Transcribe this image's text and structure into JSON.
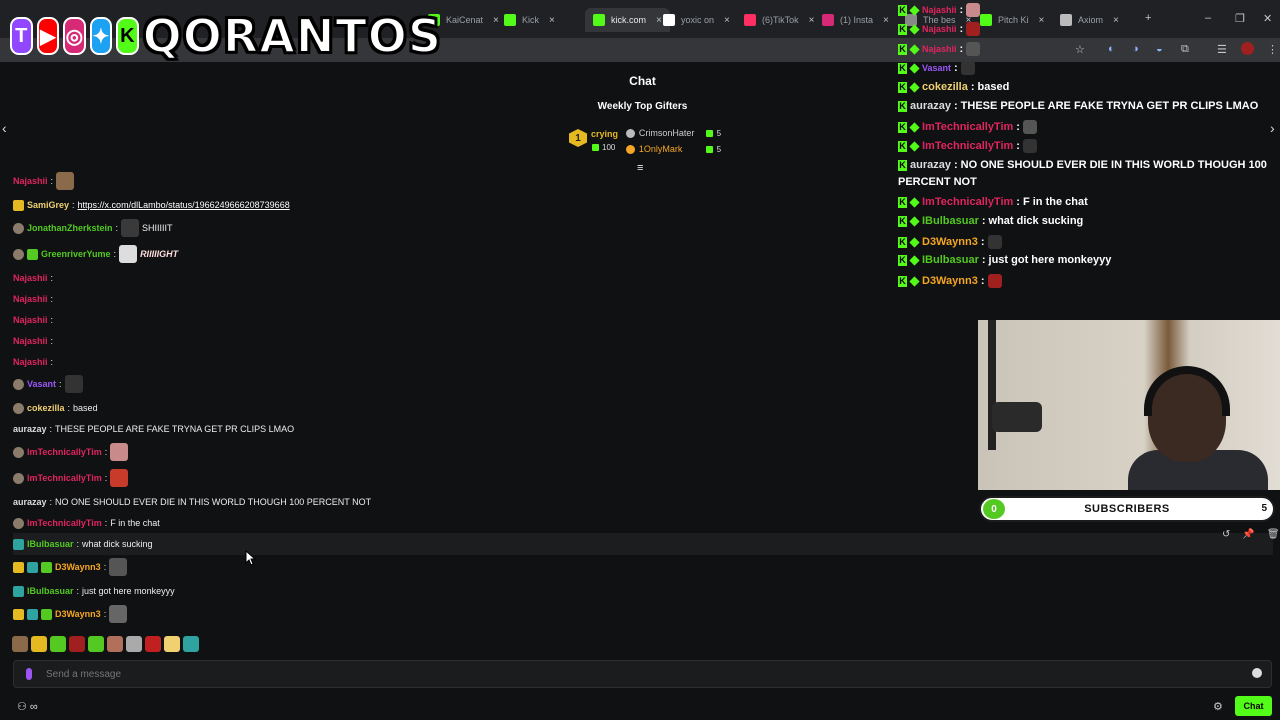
{
  "browser": {
    "tabs": [
      {
        "label": "KaiCenat",
        "color": "#53fc18",
        "active": false
      },
      {
        "label": "Kick",
        "color": "#53fc18",
        "active": false
      },
      {
        "label": "kick.com",
        "color": "#53fc18",
        "active": true
      },
      {
        "label": "yoxic on",
        "color": "#ffffff",
        "active": false
      },
      {
        "label": "(6)TikTok",
        "color": "#ff2e63",
        "active": false
      },
      {
        "label": "(1) Insta",
        "color": "#d62976",
        "active": false
      },
      {
        "label": "The bes",
        "color": "#888888",
        "active": false
      },
      {
        "label": "Pitch Ki",
        "color": "#53fc18",
        "active": false
      },
      {
        "label": "Axiom",
        "color": "#bbbbbb",
        "active": false
      }
    ],
    "new_tab": "+",
    "minimize": "–",
    "restore": "❐",
    "close": "✕"
  },
  "overlay_brand": {
    "name": "QORANTOS",
    "icons": [
      "twitch-icon",
      "youtube-icon",
      "instagram-icon",
      "twitter-icon",
      "kick-icon"
    ],
    "icon_letters": [
      "T",
      "▶",
      "◎",
      "✦",
      "K"
    ]
  },
  "chat": {
    "title": "Chat",
    "weekly_title": "Weekly Top Gifters",
    "top_gifter": {
      "rank": "1",
      "name": "crying",
      "count": "100"
    },
    "gifters": [
      {
        "name": "CrimsonHater",
        "count": "5",
        "color": "#cccccc"
      },
      {
        "name": "1OnlyMark",
        "count": "5",
        "color": "#f5a623"
      }
    ],
    "pin_icon": "≡",
    "nav_left": "‹",
    "nav_right": "›",
    "messages": [
      {
        "user": "Najashii",
        "color": "#e0245e",
        "text": "",
        "emote": "#8a6a4a"
      },
      {
        "user": "SamiGrey",
        "color": "#f0d070",
        "text": "https://x.com/dlLambo/status/1966249666208739668",
        "link": true
      },
      {
        "user": "JonathanZherkstein",
        "color": "#53c922",
        "text": "SHIIIIIT",
        "emote": "#3a3a3a"
      },
      {
        "user": "GreenriverYume",
        "color": "#53c922",
        "text": "RIIIIIGHT",
        "emote": "#ddd"
      },
      {
        "user": "Najashii",
        "color": "#e0245e",
        "text": ""
      },
      {
        "user": "Najashii",
        "color": "#e0245e",
        "text": ""
      },
      {
        "user": "Najashii",
        "color": "#e0245e",
        "text": ""
      },
      {
        "user": "Najashii",
        "color": "#e0245e",
        "text": ""
      },
      {
        "user": "Najashii",
        "color": "#e0245e",
        "text": ""
      },
      {
        "user": "Vasant",
        "color": "#9b55f5",
        "text": "",
        "emote": "#333"
      },
      {
        "user": "cokezilla",
        "color": "#f0d070",
        "text": "based"
      },
      {
        "user": "aurazay",
        "color": "#dddddd",
        "text": "THESE PEOPLE ARE FAKE TRYNA GET PR CLIPS LMAO"
      },
      {
        "user": "ImTechnicallyTim",
        "color": "#e0245e",
        "text": "",
        "emote": "#c88a8a"
      },
      {
        "user": "ImTechnicallyTim",
        "color": "#e0245e",
        "text": "",
        "emote": "#c83a2a"
      },
      {
        "user": "aurazay",
        "color": "#dddddd",
        "text": "NO ONE SHOULD EVER DIE IN THIS WORLD THOUGH 100 PERCENT NOT"
      },
      {
        "user": "ImTechnicallyTim",
        "color": "#e0245e",
        "text": "F in the chat"
      },
      {
        "user": "IBulbasuar",
        "color": "#53c922",
        "text": "what dick sucking"
      },
      {
        "user": "D3Waynn3",
        "color": "#f5a623",
        "text": "",
        "emote": "#555"
      },
      {
        "user": "IBulbasuar",
        "color": "#53c922",
        "text": "just got here monkeyyy"
      },
      {
        "user": "D3Waynn3",
        "color": "#f5a623",
        "text": "",
        "emote": "#666"
      }
    ],
    "input_placeholder": "Send a message",
    "chat_button": "Chat",
    "settings_icon": "⚙",
    "bottom_left": "⚇ ∞"
  },
  "overlay_chat": [
    {
      "user": "Najashii",
      "color": "#e0245e",
      "text": ""
    },
    {
      "user": "Najashii",
      "color": "#e0245e",
      "text": ""
    },
    {
      "user": "Najashii",
      "color": "#e0245e",
      "text": ""
    },
    {
      "user": "Vasant",
      "color": "#9b55f5",
      "text": ""
    },
    {
      "user": "cokezilla",
      "color": "#f0d070",
      "text": "based"
    },
    {
      "user": "aurazay",
      "color": "#dddddd",
      "text": "THESE PEOPLE ARE FAKE TRYNA GET PR CLIPS LMAO"
    },
    {
      "user": "ImTechnicallyTim",
      "color": "#e0245e",
      "text": ""
    },
    {
      "user": "ImTechnicallyTim",
      "color": "#e0245e",
      "text": ""
    },
    {
      "user": "aurazay",
      "color": "#dddddd",
      "text": "NO ONE SHOULD EVER DIE IN THIS WORLD THOUGH 100",
      "cont": "PERCENT NOT"
    },
    {
      "user": "ImTechnicallyTim",
      "color": "#e0245e",
      "text": "F in the chat"
    },
    {
      "user": "IBulbasuar",
      "color": "#53c922",
      "text": "what dick sucking"
    },
    {
      "user": "D3Waynn3",
      "color": "#f5a623",
      "text": ""
    },
    {
      "user": "IBulbasuar",
      "color": "#53c922",
      "text": "just got here monkeyyy"
    },
    {
      "user": "D3Waynn3",
      "color": "#f5a623",
      "text": ""
    }
  ],
  "subscribers": {
    "current": "0",
    "label": "SUBSCRIBERS",
    "goal": "5"
  },
  "message_actions": [
    "↺",
    "📌",
    "🗑"
  ]
}
